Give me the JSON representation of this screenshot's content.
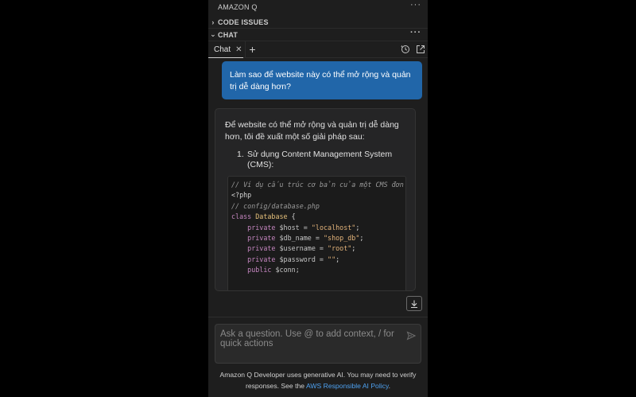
{
  "panel": {
    "title": "AMAZON Q",
    "more_icon": "ellipsis-icon",
    "sections": {
      "code_issues": "CODE ISSUES",
      "chat": "CHAT"
    }
  },
  "tabs": {
    "active_label": "Chat",
    "close_icon": "close-icon",
    "add_icon": "plus-icon",
    "history_icon": "history-icon",
    "open_external_icon": "open-in-editor-icon"
  },
  "conversation": {
    "user_message": "Làm sao để website này có thể mở rộng và quản trị dễ dàng hơn?",
    "assistant_intro": "Để website có thể mở rộng và quản trị dễ dàng hơn, tôi đề xuất một số giải pháp sau:",
    "list_items": [
      {
        "number": "1.",
        "text": "Sử dụng Content Management System (CMS):"
      }
    ],
    "code_lines": [
      "// Ví dụ cấu trúc cơ bản của một CMS đơn giản",
      "<?php",
      "// config/database.php",
      "class",
      "Database",
      "private",
      "$host = ",
      "\"localhost\"",
      "$db_name = ",
      "\"shop_db\"",
      "$username = ",
      "\"root\"",
      "$password = ",
      "\"\"",
      "public",
      "$conn;"
    ]
  },
  "composer": {
    "placeholder": "Ask a question. Use @ to add context, / for quick actions",
    "send_icon": "send-icon",
    "scroll_icon": "arrow-down-icon"
  },
  "footer": {
    "disclaimer_text": "Amazon Q Developer uses generative AI. You may need to verify responses. See the",
    "policy_link": "AWS Responsible AI Policy",
    "trailing": "."
  }
}
